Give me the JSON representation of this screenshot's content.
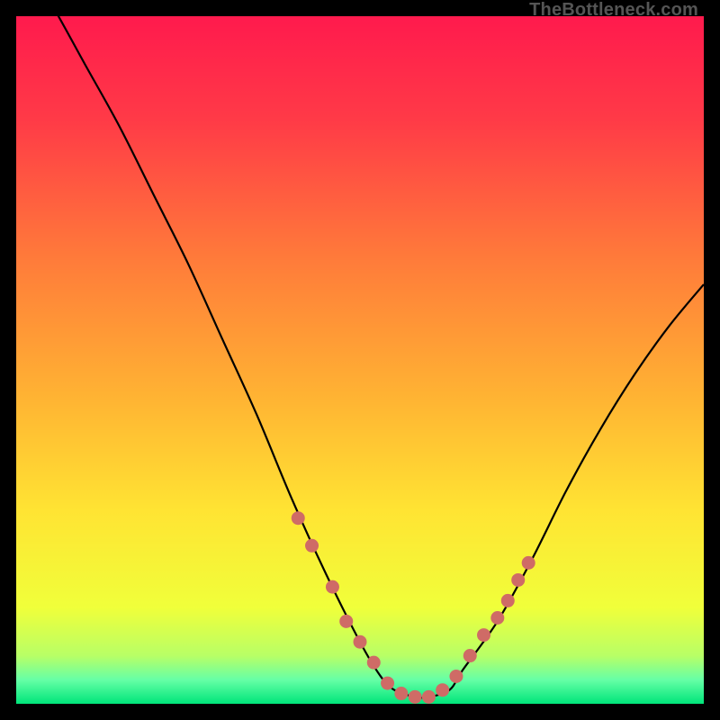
{
  "watermark": "TheBottleneck.com",
  "chart_data": {
    "type": "line",
    "title": "",
    "xlabel": "",
    "ylabel": "",
    "xlim": [
      0,
      100
    ],
    "ylim": [
      0,
      100
    ],
    "grid": false,
    "legend": false,
    "series": [
      {
        "name": "curve",
        "x": [
          0,
          5,
          10,
          15,
          20,
          25,
          30,
          35,
          40,
          45,
          50,
          53,
          55,
          58,
          60,
          63,
          65,
          70,
          75,
          80,
          85,
          90,
          95,
          100
        ],
        "y": [
          110,
          102,
          93,
          84,
          74,
          64,
          53,
          42,
          30,
          19,
          9,
          4,
          2,
          1,
          1,
          2,
          5,
          12,
          21,
          31,
          40,
          48,
          55,
          61
        ]
      }
    ],
    "highlight_dots": {
      "name": "dots",
      "color": "#cf6b66",
      "points": [
        [
          41,
          27
        ],
        [
          43,
          23
        ],
        [
          46,
          17
        ],
        [
          48,
          12
        ],
        [
          50,
          9
        ],
        [
          52,
          6
        ],
        [
          54,
          3
        ],
        [
          56,
          1.5
        ],
        [
          58,
          1
        ],
        [
          60,
          1
        ],
        [
          62,
          2
        ],
        [
          64,
          4
        ],
        [
          66,
          7
        ],
        [
          68,
          10
        ],
        [
          70,
          12.5
        ],
        [
          71.5,
          15
        ],
        [
          73,
          18
        ],
        [
          74.5,
          20.5
        ]
      ]
    },
    "background_gradient": {
      "stops": [
        {
          "offset": 0.0,
          "color": "#ff1a4d"
        },
        {
          "offset": 0.15,
          "color": "#ff3a47"
        },
        {
          "offset": 0.35,
          "color": "#ff7a3a"
        },
        {
          "offset": 0.55,
          "color": "#ffb233"
        },
        {
          "offset": 0.72,
          "color": "#ffe433"
        },
        {
          "offset": 0.86,
          "color": "#f0ff3a"
        },
        {
          "offset": 0.93,
          "color": "#b8ff66"
        },
        {
          "offset": 0.965,
          "color": "#66ffa6"
        },
        {
          "offset": 1.0,
          "color": "#00e57a"
        }
      ]
    }
  }
}
